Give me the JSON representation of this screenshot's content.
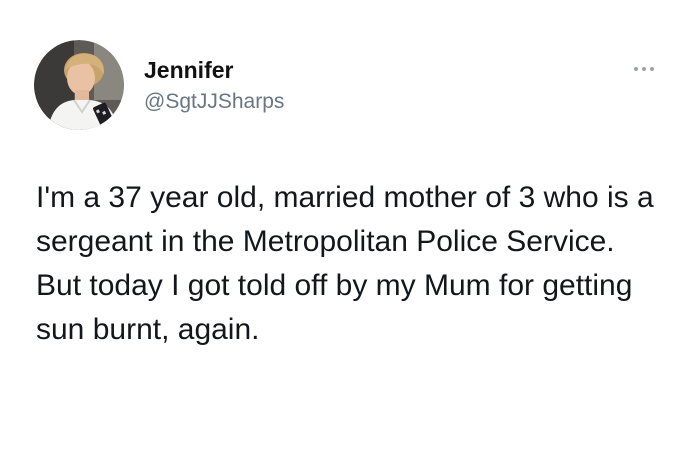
{
  "tweet": {
    "author": {
      "display_name": "Jennifer",
      "handle": "@SgtJJSharps",
      "avatar_icon": "profile-photo-avatar"
    },
    "more_icon": "more-options-icon",
    "text_lines": [
      "I'm a 37 year old, married mother of 3 who is a sergeant in the Metropolitan Police Service.",
      "But today I got told off by my Mum for getting sun burnt, again."
    ]
  },
  "colors": {
    "background": "#ffffff",
    "text": "#14171a",
    "handle": "#687684",
    "icon": "#9aa4ad"
  }
}
